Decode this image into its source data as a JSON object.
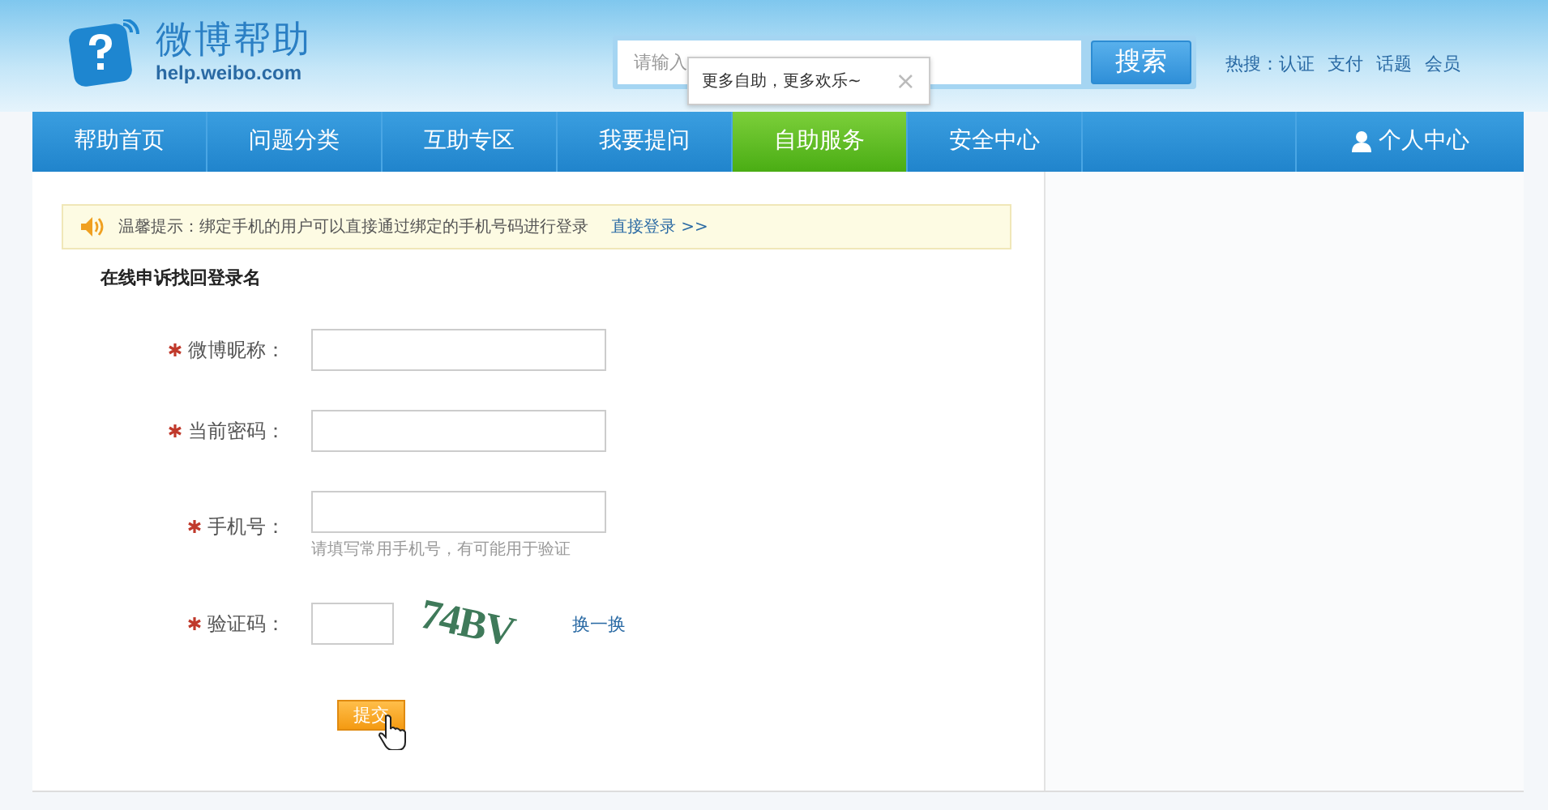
{
  "logo": {
    "title": "微博帮助",
    "subtitle": "help.weibo.com"
  },
  "search": {
    "placeholder": "请输入",
    "button": "搜索"
  },
  "tooltip": {
    "text": "更多自助，更多欢乐~",
    "close": "×"
  },
  "hot": {
    "label": "热搜：",
    "links": [
      "认证",
      "支付",
      "话题",
      "会员"
    ]
  },
  "nav": [
    {
      "label": "帮助首页",
      "selected": false
    },
    {
      "label": "问题分类",
      "selected": false
    },
    {
      "label": "互助专区",
      "selected": false
    },
    {
      "label": "我要提问",
      "selected": false
    },
    {
      "label": "自助服务",
      "selected": true
    },
    {
      "label": "安全中心",
      "selected": false
    }
  ],
  "user_nav": {
    "label": "个人中心"
  },
  "notice": {
    "text": "温馨提示：绑定手机的用户可以直接通过绑定的手机号码进行登录",
    "link": "直接登录 >>"
  },
  "form": {
    "title": "在线申诉找回登录名",
    "fields": [
      {
        "kind": "text",
        "label": "微博昵称：",
        "required": true
      },
      {
        "kind": "text",
        "label": "当前密码：",
        "required": true
      },
      {
        "kind": "text",
        "label": "手机号：",
        "required": true,
        "hint": "请填写常用手机号，有可能用于验证"
      },
      {
        "kind": "captcha",
        "label": "验证码：",
        "required": true,
        "captcha": "74BV",
        "refresh": "换一换"
      }
    ],
    "submit": "提交"
  }
}
